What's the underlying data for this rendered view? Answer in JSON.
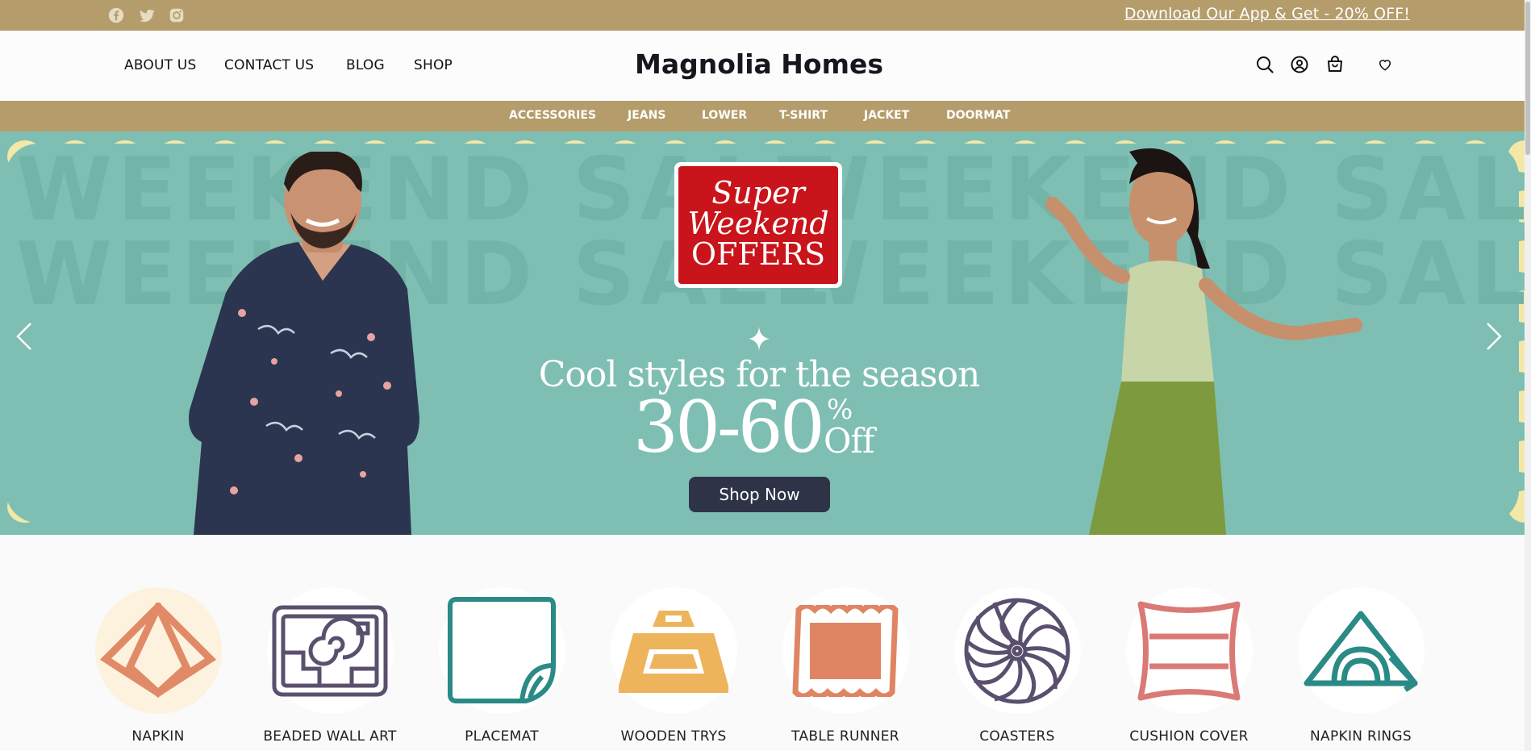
{
  "topbar": {
    "social": [
      "facebook-icon",
      "twitter-icon",
      "instagram-icon"
    ],
    "promo": "Download Our App & Get - 20% OFF!"
  },
  "header": {
    "nav": [
      "ABOUT US",
      "CONTACT US",
      "BLOG",
      "SHOP"
    ],
    "brand": "Magnolia Homes",
    "icons": [
      "search-icon",
      "account-icon",
      "cart-icon",
      "wishlist-icon"
    ]
  },
  "categories_bar": [
    "ACCESSORIES",
    "JEANS",
    "LOWER",
    "T-SHIRT",
    "JACKET",
    "DOORMAT"
  ],
  "hero": {
    "bg_text": "WEEKEND SALE",
    "badge": [
      "Super",
      "Weekend",
      "OFFERS"
    ],
    "headline": "Cool styles for the season",
    "discount": "30-60",
    "percent": "%",
    "off": "Off",
    "cta": "Shop Now"
  },
  "product_categories": [
    {
      "label": "NAPKIN",
      "icon": "napkin-icon",
      "color": "#e08a68"
    },
    {
      "label": "BEADED WALL ART",
      "icon": "wall-art-icon",
      "color": "#5b4f6e"
    },
    {
      "label": "PLACEMAT",
      "icon": "placemat-icon",
      "color": "#2a8a86"
    },
    {
      "label": "WOODEN TRYS",
      "icon": "tray-icon",
      "color": "#edb45c"
    },
    {
      "label": "TABLE RUNNER",
      "icon": "table-runner-icon",
      "color": "#e08563"
    },
    {
      "label": "COASTERS",
      "icon": "coaster-icon",
      "color": "#5b4f6e"
    },
    {
      "label": "CUSHION COVER",
      "icon": "cushion-icon",
      "color": "#d97a76"
    },
    {
      "label": "NAPKIN RINGS",
      "icon": "napkin-ring-icon",
      "color": "#2a8a86"
    }
  ],
  "colors": {
    "gold": "#b49d6b",
    "teal": "#7fbfb3",
    "badge_red": "#c8141a",
    "cta_navy": "#2f3347"
  }
}
